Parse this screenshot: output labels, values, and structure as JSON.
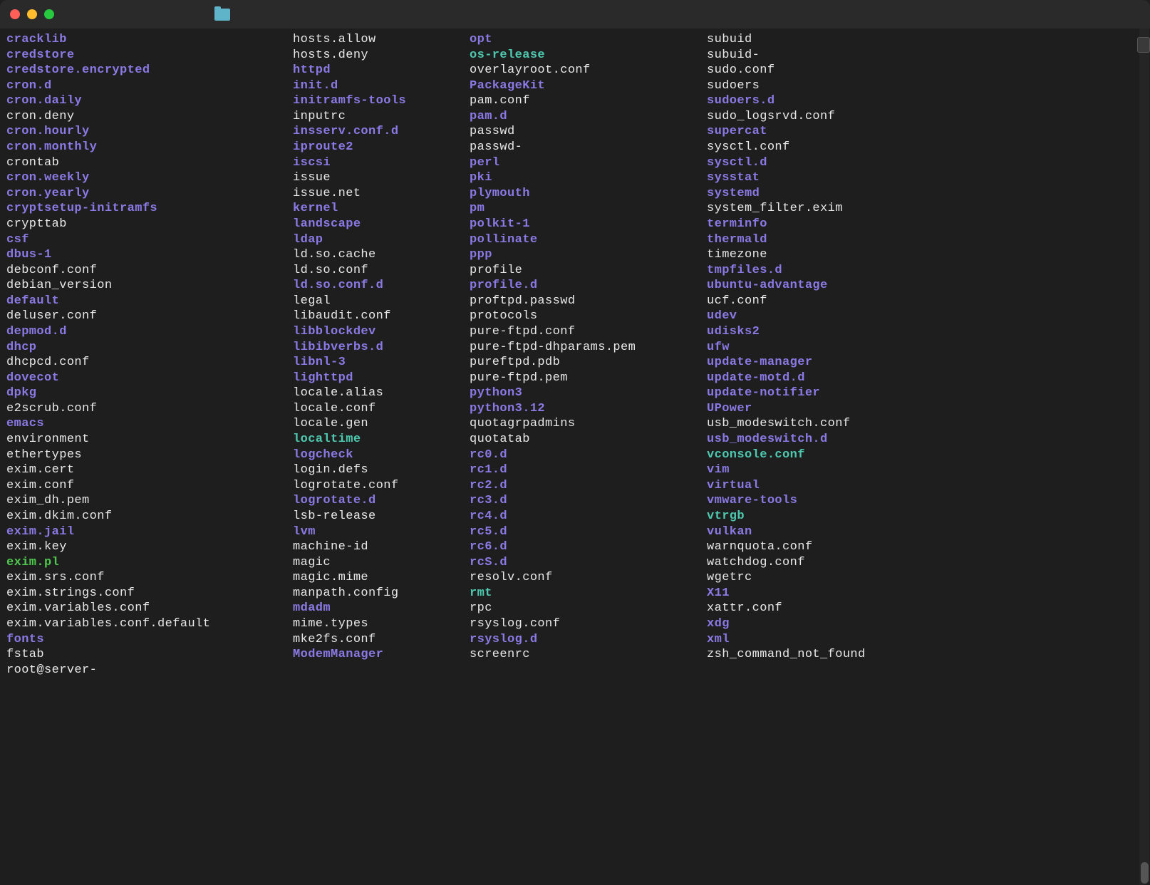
{
  "prompt": "root@server-",
  "columns": [
    [
      {
        "name": "cracklib",
        "color": "purple"
      },
      {
        "name": "credstore",
        "color": "purple"
      },
      {
        "name": "credstore.encrypted",
        "color": "purple"
      },
      {
        "name": "cron.d",
        "color": "purple"
      },
      {
        "name": "cron.daily",
        "color": "purple"
      },
      {
        "name": "cron.deny",
        "color": "white"
      },
      {
        "name": "cron.hourly",
        "color": "purple"
      },
      {
        "name": "cron.monthly",
        "color": "purple"
      },
      {
        "name": "crontab",
        "color": "white"
      },
      {
        "name": "cron.weekly",
        "color": "purple"
      },
      {
        "name": "cron.yearly",
        "color": "purple"
      },
      {
        "name": "cryptsetup-initramfs",
        "color": "purple"
      },
      {
        "name": "crypttab",
        "color": "white"
      },
      {
        "name": "csf",
        "color": "purple"
      },
      {
        "name": "dbus-1",
        "color": "purple"
      },
      {
        "name": "debconf.conf",
        "color": "white"
      },
      {
        "name": "debian_version",
        "color": "white"
      },
      {
        "name": "default",
        "color": "purple"
      },
      {
        "name": "deluser.conf",
        "color": "white"
      },
      {
        "name": "depmod.d",
        "color": "purple"
      },
      {
        "name": "dhcp",
        "color": "purple"
      },
      {
        "name": "dhcpcd.conf",
        "color": "white"
      },
      {
        "name": "dovecot",
        "color": "purple"
      },
      {
        "name": "dpkg",
        "color": "purple"
      },
      {
        "name": "e2scrub.conf",
        "color": "white"
      },
      {
        "name": "emacs",
        "color": "purple"
      },
      {
        "name": "environment",
        "color": "white"
      },
      {
        "name": "ethertypes",
        "color": "white"
      },
      {
        "name": "exim.cert",
        "color": "white"
      },
      {
        "name": "exim.conf",
        "color": "white"
      },
      {
        "name": "exim_dh.pem",
        "color": "white"
      },
      {
        "name": "exim.dkim.conf",
        "color": "white"
      },
      {
        "name": "exim.jail",
        "color": "purple"
      },
      {
        "name": "exim.key",
        "color": "white"
      },
      {
        "name": "exim.pl",
        "color": "green"
      },
      {
        "name": "exim.srs.conf",
        "color": "white"
      },
      {
        "name": "exim.strings.conf",
        "color": "white"
      },
      {
        "name": "exim.variables.conf",
        "color": "white"
      },
      {
        "name": "exim.variables.conf.default",
        "color": "white"
      },
      {
        "name": "fonts",
        "color": "purple"
      },
      {
        "name": "fstab",
        "color": "white"
      }
    ],
    [
      {
        "name": "hosts.allow",
        "color": "white"
      },
      {
        "name": "hosts.deny",
        "color": "white"
      },
      {
        "name": "httpd",
        "color": "purple"
      },
      {
        "name": "init.d",
        "color": "purple"
      },
      {
        "name": "initramfs-tools",
        "color": "purple"
      },
      {
        "name": "inputrc",
        "color": "white"
      },
      {
        "name": "insserv.conf.d",
        "color": "purple"
      },
      {
        "name": "iproute2",
        "color": "purple"
      },
      {
        "name": "iscsi",
        "color": "purple"
      },
      {
        "name": "issue",
        "color": "white"
      },
      {
        "name": "issue.net",
        "color": "white"
      },
      {
        "name": "kernel",
        "color": "purple"
      },
      {
        "name": "landscape",
        "color": "purple"
      },
      {
        "name": "ldap",
        "color": "purple"
      },
      {
        "name": "ld.so.cache",
        "color": "white"
      },
      {
        "name": "ld.so.conf",
        "color": "white"
      },
      {
        "name": "ld.so.conf.d",
        "color": "purple"
      },
      {
        "name": "legal",
        "color": "white"
      },
      {
        "name": "libaudit.conf",
        "color": "white"
      },
      {
        "name": "libblockdev",
        "color": "purple"
      },
      {
        "name": "libibverbs.d",
        "color": "purple"
      },
      {
        "name": "libnl-3",
        "color": "purple"
      },
      {
        "name": "lighttpd",
        "color": "purple"
      },
      {
        "name": "locale.alias",
        "color": "white"
      },
      {
        "name": "locale.conf",
        "color": "white"
      },
      {
        "name": "locale.gen",
        "color": "white"
      },
      {
        "name": "localtime",
        "color": "cyan"
      },
      {
        "name": "logcheck",
        "color": "purple"
      },
      {
        "name": "login.defs",
        "color": "white"
      },
      {
        "name": "logrotate.conf",
        "color": "white"
      },
      {
        "name": "logrotate.d",
        "color": "purple"
      },
      {
        "name": "lsb-release",
        "color": "white"
      },
      {
        "name": "lvm",
        "color": "purple"
      },
      {
        "name": "machine-id",
        "color": "white"
      },
      {
        "name": "magic",
        "color": "white"
      },
      {
        "name": "magic.mime",
        "color": "white"
      },
      {
        "name": "manpath.config",
        "color": "white"
      },
      {
        "name": "mdadm",
        "color": "purple"
      },
      {
        "name": "mime.types",
        "color": "white"
      },
      {
        "name": "mke2fs.conf",
        "color": "white"
      },
      {
        "name": "ModemManager",
        "color": "purple"
      }
    ],
    [
      {
        "name": "opt",
        "color": "purple"
      },
      {
        "name": "os-release",
        "color": "cyan"
      },
      {
        "name": "overlayroot.conf",
        "color": "white"
      },
      {
        "name": "PackageKit",
        "color": "purple"
      },
      {
        "name": "pam.conf",
        "color": "white"
      },
      {
        "name": "pam.d",
        "color": "purple"
      },
      {
        "name": "passwd",
        "color": "white"
      },
      {
        "name": "passwd-",
        "color": "white"
      },
      {
        "name": "perl",
        "color": "purple"
      },
      {
        "name": "pki",
        "color": "purple"
      },
      {
        "name": "plymouth",
        "color": "purple"
      },
      {
        "name": "pm",
        "color": "purple"
      },
      {
        "name": "polkit-1",
        "color": "purple"
      },
      {
        "name": "pollinate",
        "color": "purple"
      },
      {
        "name": "ppp",
        "color": "purple"
      },
      {
        "name": "profile",
        "color": "white"
      },
      {
        "name": "profile.d",
        "color": "purple"
      },
      {
        "name": "proftpd.passwd",
        "color": "white"
      },
      {
        "name": "protocols",
        "color": "white"
      },
      {
        "name": "pure-ftpd.conf",
        "color": "white"
      },
      {
        "name": "pure-ftpd-dhparams.pem",
        "color": "white"
      },
      {
        "name": "pureftpd.pdb",
        "color": "white"
      },
      {
        "name": "pure-ftpd.pem",
        "color": "white"
      },
      {
        "name": "python3",
        "color": "purple"
      },
      {
        "name": "python3.12",
        "color": "purple"
      },
      {
        "name": "quotagrpadmins",
        "color": "white"
      },
      {
        "name": "quotatab",
        "color": "white"
      },
      {
        "name": "rc0.d",
        "color": "purple"
      },
      {
        "name": "rc1.d",
        "color": "purple"
      },
      {
        "name": "rc2.d",
        "color": "purple"
      },
      {
        "name": "rc3.d",
        "color": "purple"
      },
      {
        "name": "rc4.d",
        "color": "purple"
      },
      {
        "name": "rc5.d",
        "color": "purple"
      },
      {
        "name": "rc6.d",
        "color": "purple"
      },
      {
        "name": "rcS.d",
        "color": "purple"
      },
      {
        "name": "resolv.conf",
        "color": "white"
      },
      {
        "name": "rmt",
        "color": "cyan"
      },
      {
        "name": "rpc",
        "color": "white"
      },
      {
        "name": "rsyslog.conf",
        "color": "white"
      },
      {
        "name": "rsyslog.d",
        "color": "purple"
      },
      {
        "name": "screenrc",
        "color": "white"
      }
    ],
    [
      {
        "name": "subuid",
        "color": "white"
      },
      {
        "name": "subuid-",
        "color": "white"
      },
      {
        "name": "sudo.conf",
        "color": "white"
      },
      {
        "name": "sudoers",
        "color": "white"
      },
      {
        "name": "sudoers.d",
        "color": "purple"
      },
      {
        "name": "sudo_logsrvd.conf",
        "color": "white"
      },
      {
        "name": "supercat",
        "color": "purple"
      },
      {
        "name": "sysctl.conf",
        "color": "white"
      },
      {
        "name": "sysctl.d",
        "color": "purple"
      },
      {
        "name": "sysstat",
        "color": "purple"
      },
      {
        "name": "systemd",
        "color": "purple"
      },
      {
        "name": "system_filter.exim",
        "color": "white"
      },
      {
        "name": "terminfo",
        "color": "purple"
      },
      {
        "name": "thermald",
        "color": "purple"
      },
      {
        "name": "timezone",
        "color": "white"
      },
      {
        "name": "tmpfiles.d",
        "color": "purple"
      },
      {
        "name": "ubuntu-advantage",
        "color": "purple"
      },
      {
        "name": "ucf.conf",
        "color": "white"
      },
      {
        "name": "udev",
        "color": "purple"
      },
      {
        "name": "udisks2",
        "color": "purple"
      },
      {
        "name": "ufw",
        "color": "purple"
      },
      {
        "name": "update-manager",
        "color": "purple"
      },
      {
        "name": "update-motd.d",
        "color": "purple"
      },
      {
        "name": "update-notifier",
        "color": "purple"
      },
      {
        "name": "UPower",
        "color": "purple"
      },
      {
        "name": "usb_modeswitch.conf",
        "color": "white"
      },
      {
        "name": "usb_modeswitch.d",
        "color": "purple"
      },
      {
        "name": "vconsole.conf",
        "color": "cyan"
      },
      {
        "name": "vim",
        "color": "purple"
      },
      {
        "name": "virtual",
        "color": "purple"
      },
      {
        "name": "vmware-tools",
        "color": "purple"
      },
      {
        "name": "vtrgb",
        "color": "cyan"
      },
      {
        "name": "vulkan",
        "color": "purple"
      },
      {
        "name": "warnquota.conf",
        "color": "white"
      },
      {
        "name": "watchdog.conf",
        "color": "white"
      },
      {
        "name": "wgetrc",
        "color": "white"
      },
      {
        "name": "X11",
        "color": "purple"
      },
      {
        "name": "xattr.conf",
        "color": "white"
      },
      {
        "name": "xdg",
        "color": "purple"
      },
      {
        "name": "xml",
        "color": "purple"
      },
      {
        "name": "zsh_command_not_found",
        "color": "white"
      }
    ]
  ]
}
